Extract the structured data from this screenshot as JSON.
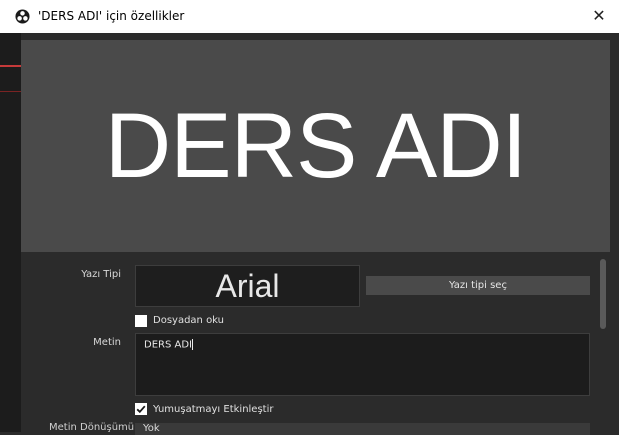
{
  "window": {
    "title": "'DERS ADI' için özellikler",
    "close_glyph": "✕",
    "icon": "obs-logo-icon"
  },
  "preview": {
    "text": "DERS ADI"
  },
  "properties": {
    "font": {
      "label": "Yazı Tipi",
      "value": "Arial",
      "select_button": "Yazı tipi seç"
    },
    "read_from_file": {
      "label": "Dosyadan oku",
      "checked": false
    },
    "text": {
      "label": "Metin",
      "value": "DERS ADI"
    },
    "antialias": {
      "label": "Yumuşatmayı Etkinleştir",
      "checked": true
    },
    "transform": {
      "label": "Metin Dönüşümü",
      "value": "Yok"
    }
  },
  "colors": {
    "preview_bg": "#4a4a4a",
    "panel_bg": "#2b2b2b",
    "accent": "#ffffff"
  }
}
